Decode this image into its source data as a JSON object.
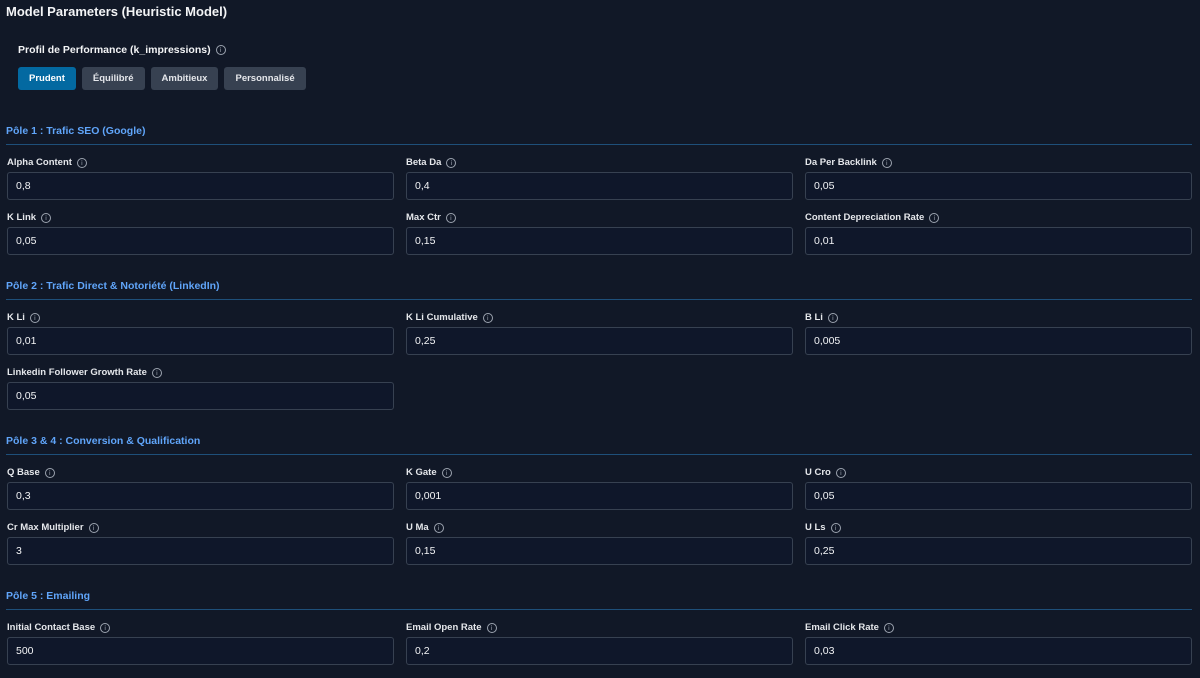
{
  "title": "Model Parameters (Heuristic Model)",
  "profile": {
    "label": "Profil de Performance (k_impressions)",
    "options": [
      "Prudent",
      "Équilibré",
      "Ambitieux",
      "Personnalisé"
    ],
    "selected": "Prudent"
  },
  "sections": [
    {
      "title": "Pôle 1 : Trafic SEO (Google)",
      "fields": [
        {
          "label": "Alpha Content",
          "value": "0,8"
        },
        {
          "label": "Beta Da",
          "value": "0,4"
        },
        {
          "label": "Da Per Backlink",
          "value": "0,05"
        },
        {
          "label": "K Link",
          "value": "0,05"
        },
        {
          "label": "Max Ctr",
          "value": "0,15"
        },
        {
          "label": "Content Depreciation Rate",
          "value": "0,01"
        }
      ]
    },
    {
      "title": "Pôle 2 : Trafic Direct & Notoriété (LinkedIn)",
      "fields": [
        {
          "label": "K Li",
          "value": "0,01"
        },
        {
          "label": "K Li Cumulative",
          "value": "0,25"
        },
        {
          "label": "B Li",
          "value": "0,005"
        },
        {
          "label": "Linkedin Follower Growth Rate",
          "value": "0,05"
        }
      ]
    },
    {
      "title": "Pôle 3 & 4 : Conversion & Qualification",
      "fields": [
        {
          "label": "Q Base",
          "value": "0,3"
        },
        {
          "label": "K Gate",
          "value": "0,001"
        },
        {
          "label": "U Cro",
          "value": "0,05"
        },
        {
          "label": "Cr Max Multiplier",
          "value": "3"
        },
        {
          "label": "U Ma",
          "value": "0,15"
        },
        {
          "label": "U Ls",
          "value": "0,25"
        }
      ]
    },
    {
      "title": "Pôle 5 : Emailing",
      "fields": [
        {
          "label": "Initial Contact Base",
          "value": "500"
        },
        {
          "label": "Email Open Rate",
          "value": "0,2"
        },
        {
          "label": "Email Click Rate",
          "value": "0,03"
        }
      ]
    }
  ],
  "icons": {
    "info": "info-circle-icon"
  },
  "colors": {
    "background": "#111827",
    "accent": "#0369a1",
    "section_title": "#60a5fa"
  }
}
